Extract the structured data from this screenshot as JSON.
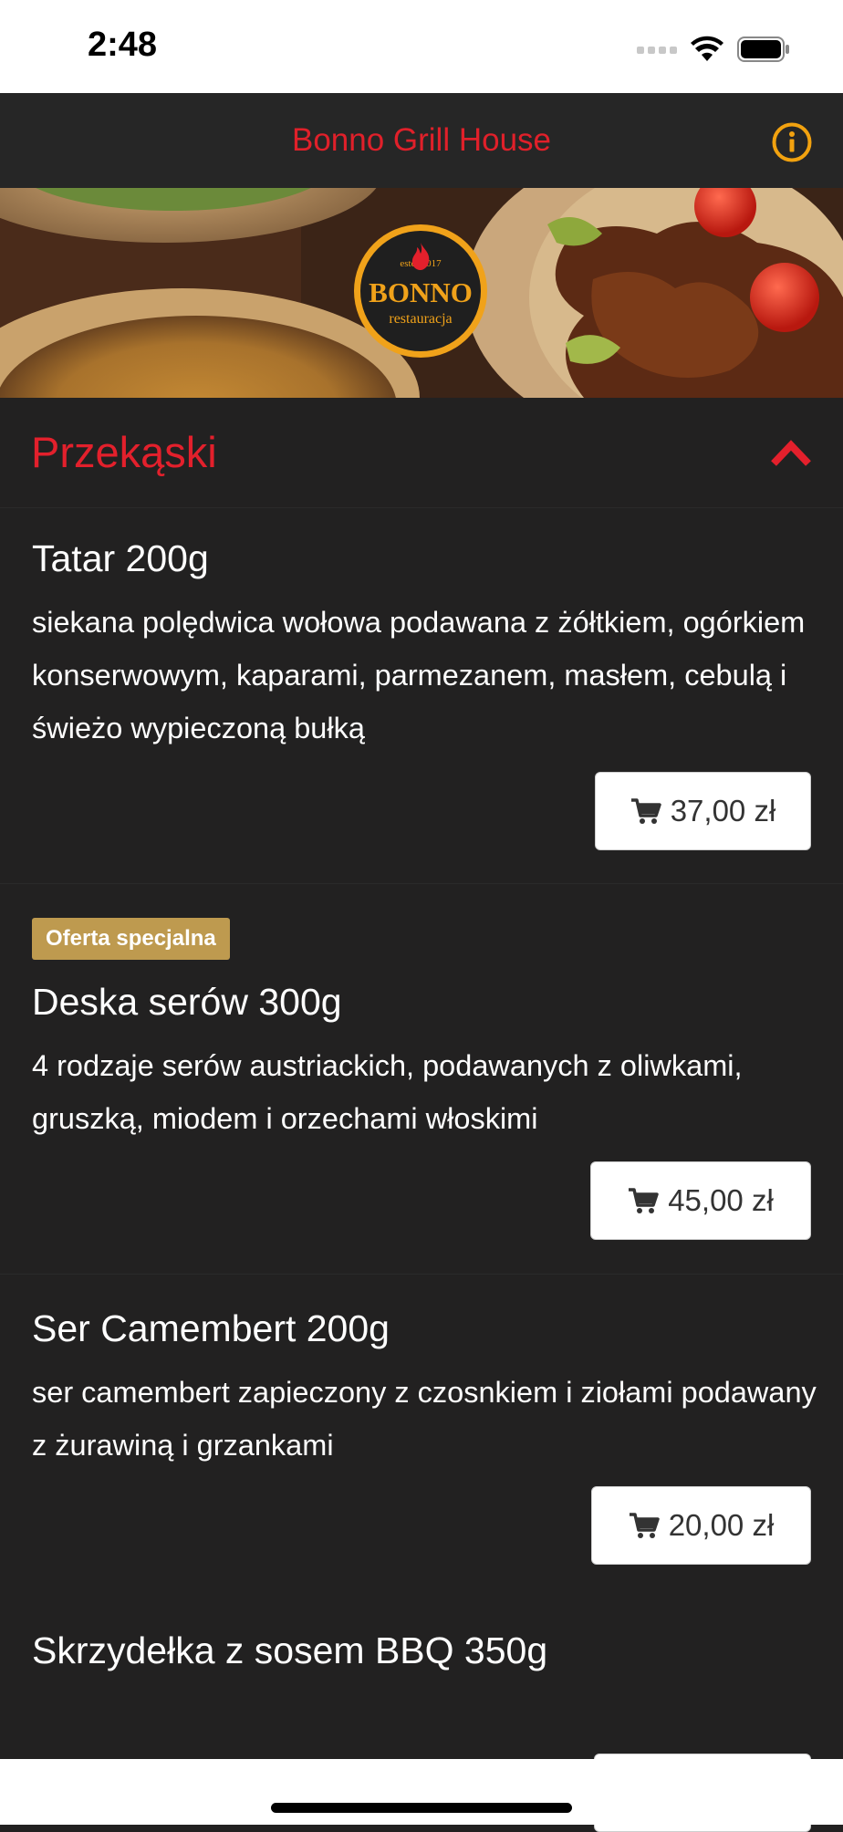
{
  "status_bar": {
    "time": "2:48"
  },
  "nav": {
    "title": "Bonno Grill House",
    "info_icon": "info-circle-icon"
  },
  "hero": {
    "logo_top": "estd. 2017",
    "logo_name": "BONNO",
    "logo_sub": "restauracja"
  },
  "section": {
    "title": "Przekąski",
    "toggle_icon": "chevron-up-icon"
  },
  "items": [
    {
      "title": "Tatar 200g",
      "description": "siekana polędwica wołowa podawana z żółtkiem, ogórkiem konserwowym, kaparami, parmezanem, masłem, cebulą i świeżo wypieczoną bułką",
      "price": "37,00 zł"
    },
    {
      "badge": "Oferta specjalna",
      "title": "Deska serów 300g",
      "description": "4 rodzaje serów austriackich, podawanych z oliwkami, gruszką, miodem i orzechami włoskimi",
      "price": "45,00 zł"
    },
    {
      "title": "Ser Camembert 200g",
      "description": "ser camembert zapieczony z czosnkiem i ziołami podawany z żurawiną i grzankami",
      "price": "20,00 zł"
    },
    {
      "title": "Skrzydełka z sosem BBQ 350g"
    }
  ],
  "colors": {
    "accent_red": "#e3202c",
    "badge_gold": "#be9a4f",
    "info_orange": "#f2a20f",
    "background": "#222121"
  }
}
